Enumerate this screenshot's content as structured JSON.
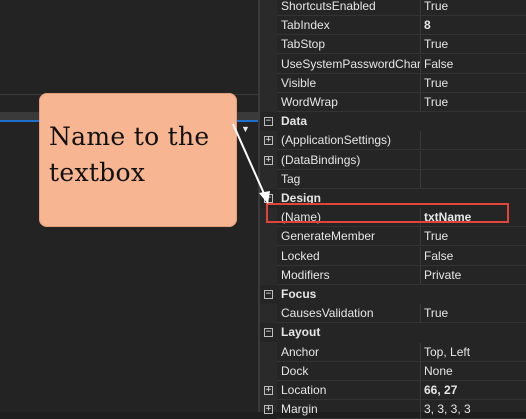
{
  "callout": {
    "text": "Name to the textbox"
  },
  "properties": [
    {
      "type": "prop",
      "name": "ShortcutsEnabled",
      "value": "True"
    },
    {
      "type": "prop",
      "name": "TabIndex",
      "value": "8",
      "bold": true
    },
    {
      "type": "prop",
      "name": "TabStop",
      "value": "True"
    },
    {
      "type": "prop",
      "name": "UseSystemPasswordChar",
      "value": "False"
    },
    {
      "type": "prop",
      "name": "Visible",
      "value": "True"
    },
    {
      "type": "prop",
      "name": "WordWrap",
      "value": "True"
    },
    {
      "type": "category",
      "name": "Data",
      "state": "expanded"
    },
    {
      "type": "prop",
      "name": "(ApplicationSettings)",
      "value": "",
      "expandable": true
    },
    {
      "type": "prop",
      "name": "(DataBindings)",
      "value": "",
      "expandable": true
    },
    {
      "type": "prop",
      "name": "Tag",
      "value": ""
    },
    {
      "type": "category",
      "name": "Design",
      "state": "expanded"
    },
    {
      "type": "prop",
      "name": "(Name)",
      "value": "txtName",
      "bold": true,
      "highlighted": true
    },
    {
      "type": "prop",
      "name": "GenerateMember",
      "value": "True"
    },
    {
      "type": "prop",
      "name": "Locked",
      "value": "False"
    },
    {
      "type": "prop",
      "name": "Modifiers",
      "value": "Private"
    },
    {
      "type": "category",
      "name": "Focus",
      "state": "expanded"
    },
    {
      "type": "prop",
      "name": "CausesValidation",
      "value": "True"
    },
    {
      "type": "category",
      "name": "Layout",
      "state": "expanded"
    },
    {
      "type": "prop",
      "name": "Anchor",
      "value": "Top, Left"
    },
    {
      "type": "prop",
      "name": "Dock",
      "value": "None"
    },
    {
      "type": "prop",
      "name": "Location",
      "value": "66, 27",
      "bold": true,
      "expandable": true
    },
    {
      "type": "prop",
      "name": "Margin",
      "value": "3, 3, 3, 3",
      "expandable": true
    }
  ],
  "colors": {
    "highlight_border": "#e0453a",
    "callout_fill": "#f7b591",
    "accent_blue": "#1f6fd1"
  }
}
